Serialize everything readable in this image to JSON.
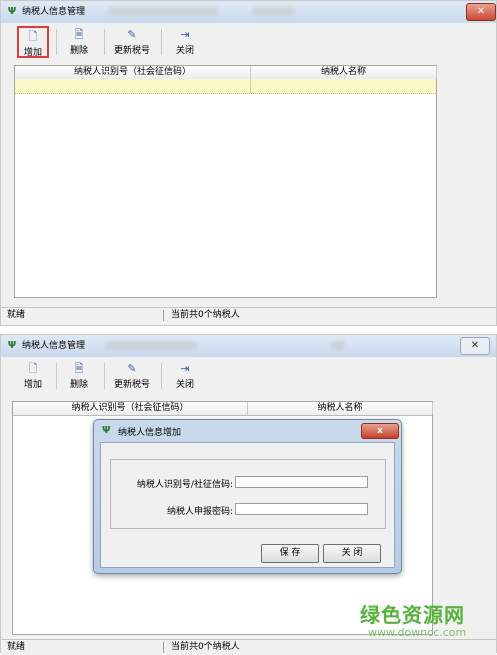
{
  "window_top": {
    "title": "纳税人信息管理",
    "toolbar": [
      {
        "label": "增加",
        "icon": "add-document-icon",
        "selected": true
      },
      {
        "label": "删除",
        "icon": "delete-document-icon"
      },
      {
        "label": "更新税号",
        "icon": "edit-icon"
      },
      {
        "label": "关闭",
        "icon": "exit-door-icon"
      }
    ],
    "grid": {
      "columns": [
        "纳税人识别号（社会征信码）",
        "纳税人名称"
      ]
    },
    "status": {
      "left": "就绪",
      "right": "当前共0个纳税人"
    }
  },
  "window_bottom": {
    "title": "纳税人信息管理",
    "close_glyph": "✕",
    "toolbar": [
      {
        "label": "增加",
        "icon": "add-document-icon"
      },
      {
        "label": "删除",
        "icon": "delete-document-icon"
      },
      {
        "label": "更新税号",
        "icon": "edit-icon"
      },
      {
        "label": "关闭",
        "icon": "exit-door-icon"
      }
    ],
    "grid": {
      "columns": [
        "纳税人识别号（社会征信码）",
        "纳税人名称"
      ]
    },
    "status": {
      "left": "就绪",
      "right": "当前共0个纳税人"
    }
  },
  "dialog": {
    "title": "纳税人信息增加",
    "close_glyph": "x",
    "taxpayer_id_label": "纳税人识别号/社征信码:",
    "taxpayer_id_value": "",
    "password_label": "纳税人申报密码:",
    "password_value": "",
    "save_label": "保 存",
    "close_label": "关 闭"
  },
  "watermark": {
    "brand": "绿色资源网",
    "url": "www.downcc.com"
  },
  "colors": {
    "accent_green": "#56b23a",
    "selected_border": "#e23b3b",
    "row_highlight": "#fbf8c8"
  }
}
